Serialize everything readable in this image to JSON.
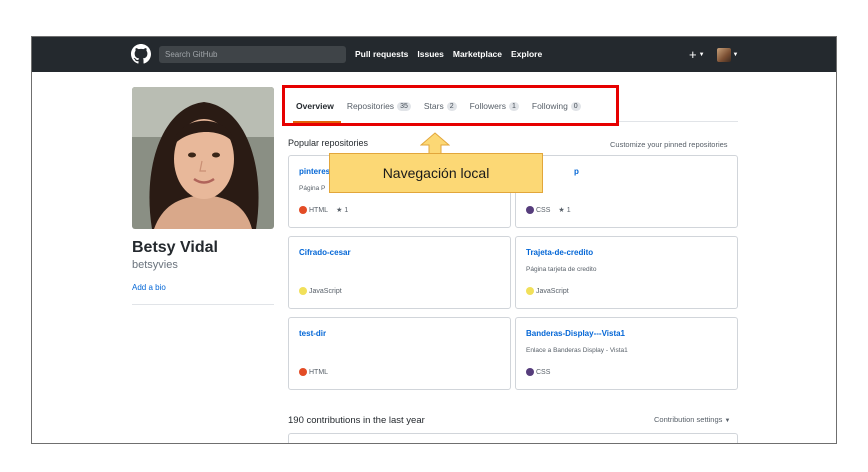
{
  "header": {
    "search_placeholder": "Search GitHub",
    "nav": [
      "Pull requests",
      "Issues",
      "Marketplace",
      "Explore"
    ],
    "plus_label": "+"
  },
  "profile": {
    "name": "Betsy Vidal",
    "login": "betsyvies",
    "add_bio": "Add a bio"
  },
  "tabs": [
    {
      "label": "Overview",
      "count": null,
      "selected": true
    },
    {
      "label": "Repositories",
      "count": "35",
      "selected": false
    },
    {
      "label": "Stars",
      "count": "2",
      "selected": false
    },
    {
      "label": "Followers",
      "count": "1",
      "selected": false
    },
    {
      "label": "Following",
      "count": "0",
      "selected": false
    }
  ],
  "popular": {
    "title": "Popular repositories",
    "customize": "Customize your pinned repositories"
  },
  "repos": [
    {
      "name": "pinteres",
      "description": "Página P",
      "language": "HTML",
      "lang_color": "#e34c26",
      "stars": "1"
    },
    {
      "name": "p",
      "description": "",
      "language": "CSS",
      "lang_color": "#563d7c",
      "stars": "1"
    },
    {
      "name": "Cifrado-cesar",
      "description": "",
      "language": "JavaScript",
      "lang_color": "#f1e05a",
      "stars": ""
    },
    {
      "name": "Trajeta-de-credito",
      "description": "Página tarjeta de credito",
      "language": "JavaScript",
      "lang_color": "#f1e05a",
      "stars": ""
    },
    {
      "name": "test-dir",
      "description": "",
      "language": "HTML",
      "lang_color": "#e34c26",
      "stars": ""
    },
    {
      "name": "Banderas-Display---Vista1",
      "description": "Enlace a Banderas Display - Vista1",
      "language": "CSS",
      "lang_color": "#563d7c",
      "stars": ""
    }
  ],
  "callout": {
    "text": "Navegación local"
  },
  "contributions": {
    "title": "190 contributions in the last year",
    "settings": "Contribution settings"
  },
  "colors": {
    "header_bg": "#24292e",
    "highlight_border": "#e60000",
    "callout_bg": "#fcd875",
    "link": "#0366d6",
    "tab_underline": "#e36209"
  }
}
